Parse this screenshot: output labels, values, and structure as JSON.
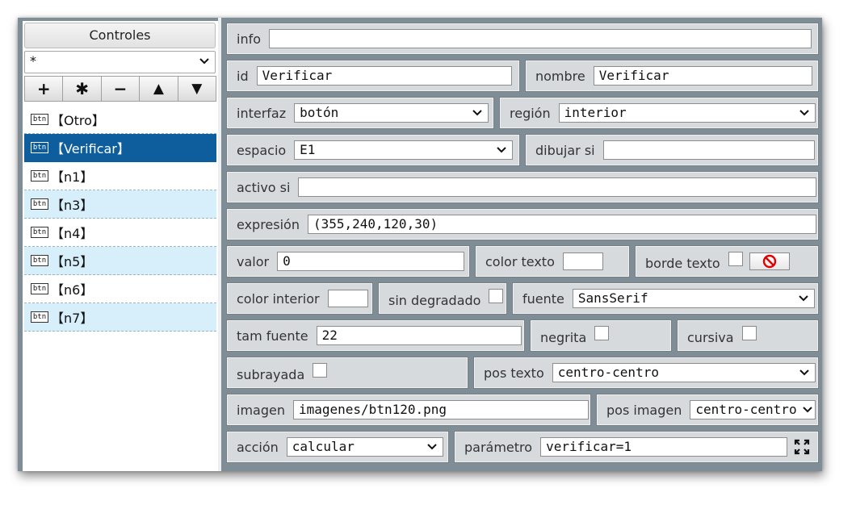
{
  "controls": {
    "title": "Controles",
    "filter_value": "*",
    "toolbar": [
      "+",
      "✱",
      "−",
      "▲",
      "▼"
    ],
    "items": [
      {
        "icon": "btn",
        "label": "【Otro】",
        "state": "normal"
      },
      {
        "icon": "btn",
        "label": "【Verificar】",
        "state": "selected"
      },
      {
        "icon": "btn",
        "label": "【n1】",
        "state": "normal"
      },
      {
        "icon": "btn",
        "label": "【n3】",
        "state": "alt"
      },
      {
        "icon": "btn",
        "label": "【n4】",
        "state": "normal"
      },
      {
        "icon": "btn",
        "label": "【n5】",
        "state": "alt"
      },
      {
        "icon": "btn",
        "label": "【n6】",
        "state": "normal"
      },
      {
        "icon": "btn",
        "label": "【n7】",
        "state": "alt"
      }
    ]
  },
  "props": {
    "info": {
      "label": "info",
      "value": ""
    },
    "id": {
      "label": "id",
      "value": "Verificar"
    },
    "nombre": {
      "label": "nombre",
      "value": "Verificar"
    },
    "interfaz": {
      "label": "interfaz",
      "value": "botón"
    },
    "region": {
      "label": "región",
      "value": "interior"
    },
    "espacio": {
      "label": "espacio",
      "value": "E1"
    },
    "dibujar_si": {
      "label": "dibujar si",
      "value": ""
    },
    "activo_si": {
      "label": "activo si",
      "value": ""
    },
    "expresion": {
      "label": "expresión",
      "value": "(355,240,120,30)"
    },
    "valor": {
      "label": "valor",
      "value": "0"
    },
    "color_texto": {
      "label": "color texto",
      "color": "#ffffff"
    },
    "borde_texto": {
      "label": "borde texto",
      "checked": false
    },
    "color_interior": {
      "label": "color interior",
      "color": "#ffffff"
    },
    "sin_degradado": {
      "label": "sin degradado",
      "checked": false
    },
    "fuente": {
      "label": "fuente",
      "value": "SansSerif"
    },
    "tam_fuente": {
      "label": "tam fuente",
      "value": "22"
    },
    "negrita": {
      "label": "negrita",
      "checked": false
    },
    "cursiva": {
      "label": "cursiva",
      "checked": false
    },
    "subrayada": {
      "label": "subrayada",
      "checked": false
    },
    "pos_texto": {
      "label": "pos texto",
      "value": "centro-centro"
    },
    "imagen": {
      "label": "imagen",
      "value": "imagenes/btn120.png"
    },
    "pos_imagen": {
      "label": "pos imagen",
      "value": "centro-centro"
    },
    "accion": {
      "label": "acción",
      "value": "calcular"
    },
    "parametro": {
      "label": "parámetro",
      "value": "verificar=1"
    }
  },
  "colors": {
    "frame": "#7f8d96",
    "cell_bg": "#d6dadd",
    "selected_row": "#0e5e9e",
    "alt_row": "#d7eefb",
    "no_color_icon": "#e00000"
  },
  "icons": {
    "dropdown": "chevron-down-icon",
    "no_color": "prohibited-icon",
    "expand": "expand-icon"
  }
}
